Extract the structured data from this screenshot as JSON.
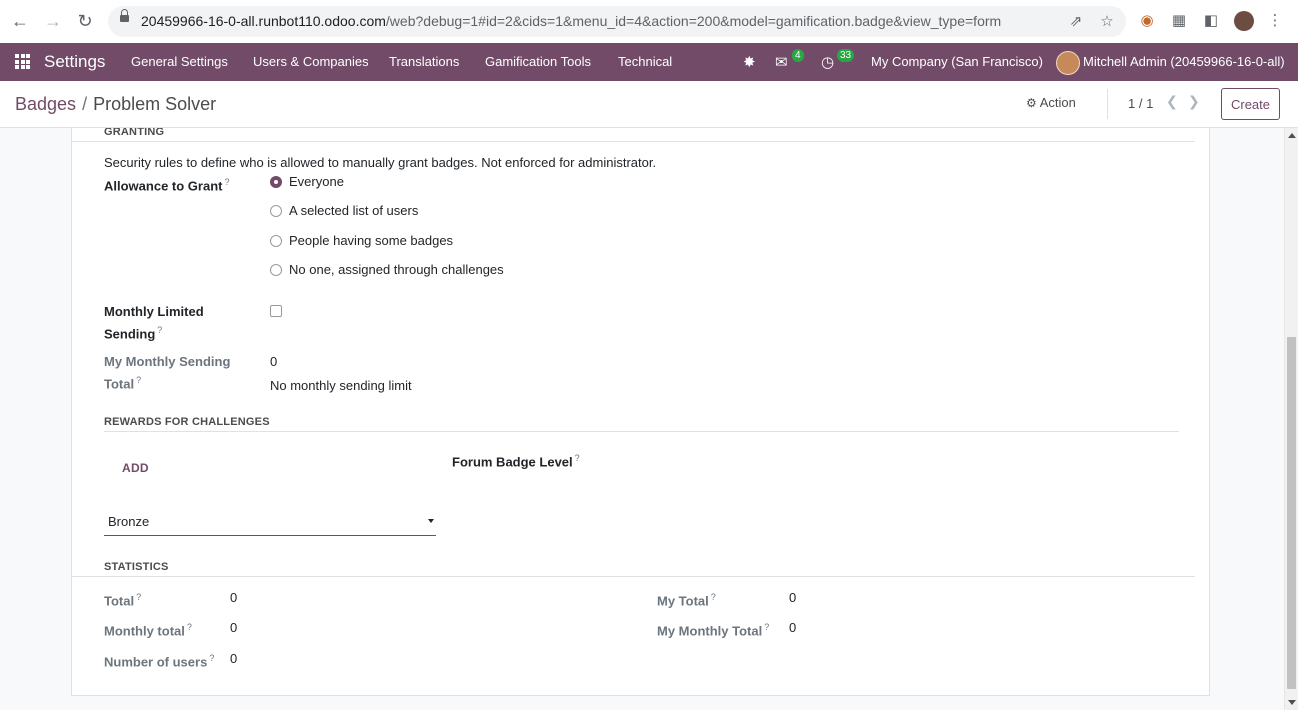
{
  "browser": {
    "url_host": "20459966-16-0-all.runbot110.odoo.com",
    "url_path": "/web?debug=1#id=2&cids=1&menu_id=4&action=200&model=gamification.badge&view_type=form"
  },
  "navbar": {
    "app_name": "Settings",
    "menu": [
      "General Settings",
      "Users & Companies",
      "Translations",
      "Gamification Tools",
      "Technical"
    ],
    "messages_count": "4",
    "activities_count": "33",
    "company": "My Company (San Francisco)",
    "user": "Mitchell Admin (20459966-16-0-all)"
  },
  "control_panel": {
    "breadcrumb_parent": "Badges",
    "breadcrumb_sep": "/",
    "breadcrumb_current": "Problem Solver",
    "action_label": "Action",
    "pager": "1 / 1",
    "create_label": "Create"
  },
  "granting": {
    "title": "GRANTING",
    "description": "Security rules to define who is allowed to manually grant badges. Not enforced for administrator.",
    "allowance_label": "Allowance to Grant",
    "options": [
      "Everyone",
      "A selected list of users",
      "People having some badges",
      "No one, assigned through challenges"
    ],
    "selected": "Everyone",
    "monthly_limited_label_1": "Monthly Limited",
    "monthly_limited_label_2": "Sending",
    "monthly_limited_checked": false,
    "my_monthly_label_1": "My Monthly Sending",
    "my_monthly_label_2": "Total",
    "my_monthly_value": "0",
    "no_limit_text": "No monthly sending limit"
  },
  "rewards": {
    "title": "REWARDS FOR CHALLENGES",
    "add_label": "ADD",
    "forum_level_label": "Forum Badge Level",
    "forum_level_value": "Bronze"
  },
  "statistics": {
    "title": "STATISTICS",
    "total_label": "Total",
    "total_value": "0",
    "monthly_total_label": "Monthly total",
    "monthly_total_value": "0",
    "num_users_label": "Number of users",
    "num_users_value": "0",
    "my_total_label": "My Total",
    "my_total_value": "0",
    "my_monthly_total_label": "My Monthly Total",
    "my_monthly_total_value": "0"
  },
  "help_marker": "?",
  "colors": {
    "brand": "#714b67",
    "badge_green": "#28a745"
  }
}
